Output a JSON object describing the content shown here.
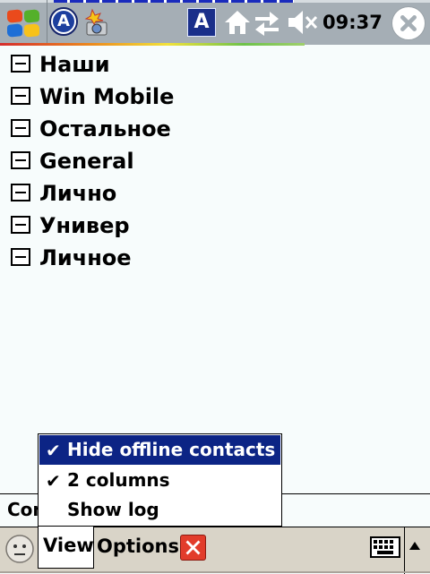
{
  "status_bar": {
    "clock": "09:37",
    "input_indicator": "A",
    "im_indicator": "A",
    "icons": [
      "windows-start-icon",
      "im-status-icon",
      "camera-icon",
      "input-method-icon",
      "home-icon",
      "sync-icon",
      "volume-muted-icon",
      "close-icon"
    ]
  },
  "groups": [
    {
      "label": "Наши"
    },
    {
      "label": "Win Mobile"
    },
    {
      "label": "Остальное"
    },
    {
      "label": "General"
    },
    {
      "label": "Лично"
    },
    {
      "label": "Универ"
    },
    {
      "label": "Личное"
    }
  ],
  "status_text": "Con",
  "view_menu": {
    "items": [
      {
        "label": "Hide offline contacts",
        "checked": "✔"
      },
      {
        "label": "2 columns",
        "checked": "✔"
      },
      {
        "label": "Show log",
        "checked": ""
      }
    ]
  },
  "menubar": {
    "view_label": "View",
    "options_label": "Options"
  },
  "colors": {
    "menu_highlight": "#0c2485",
    "status_bar": "#a5aeb5",
    "menubar": "#d9d4c8",
    "background": "#f7fcfc"
  }
}
